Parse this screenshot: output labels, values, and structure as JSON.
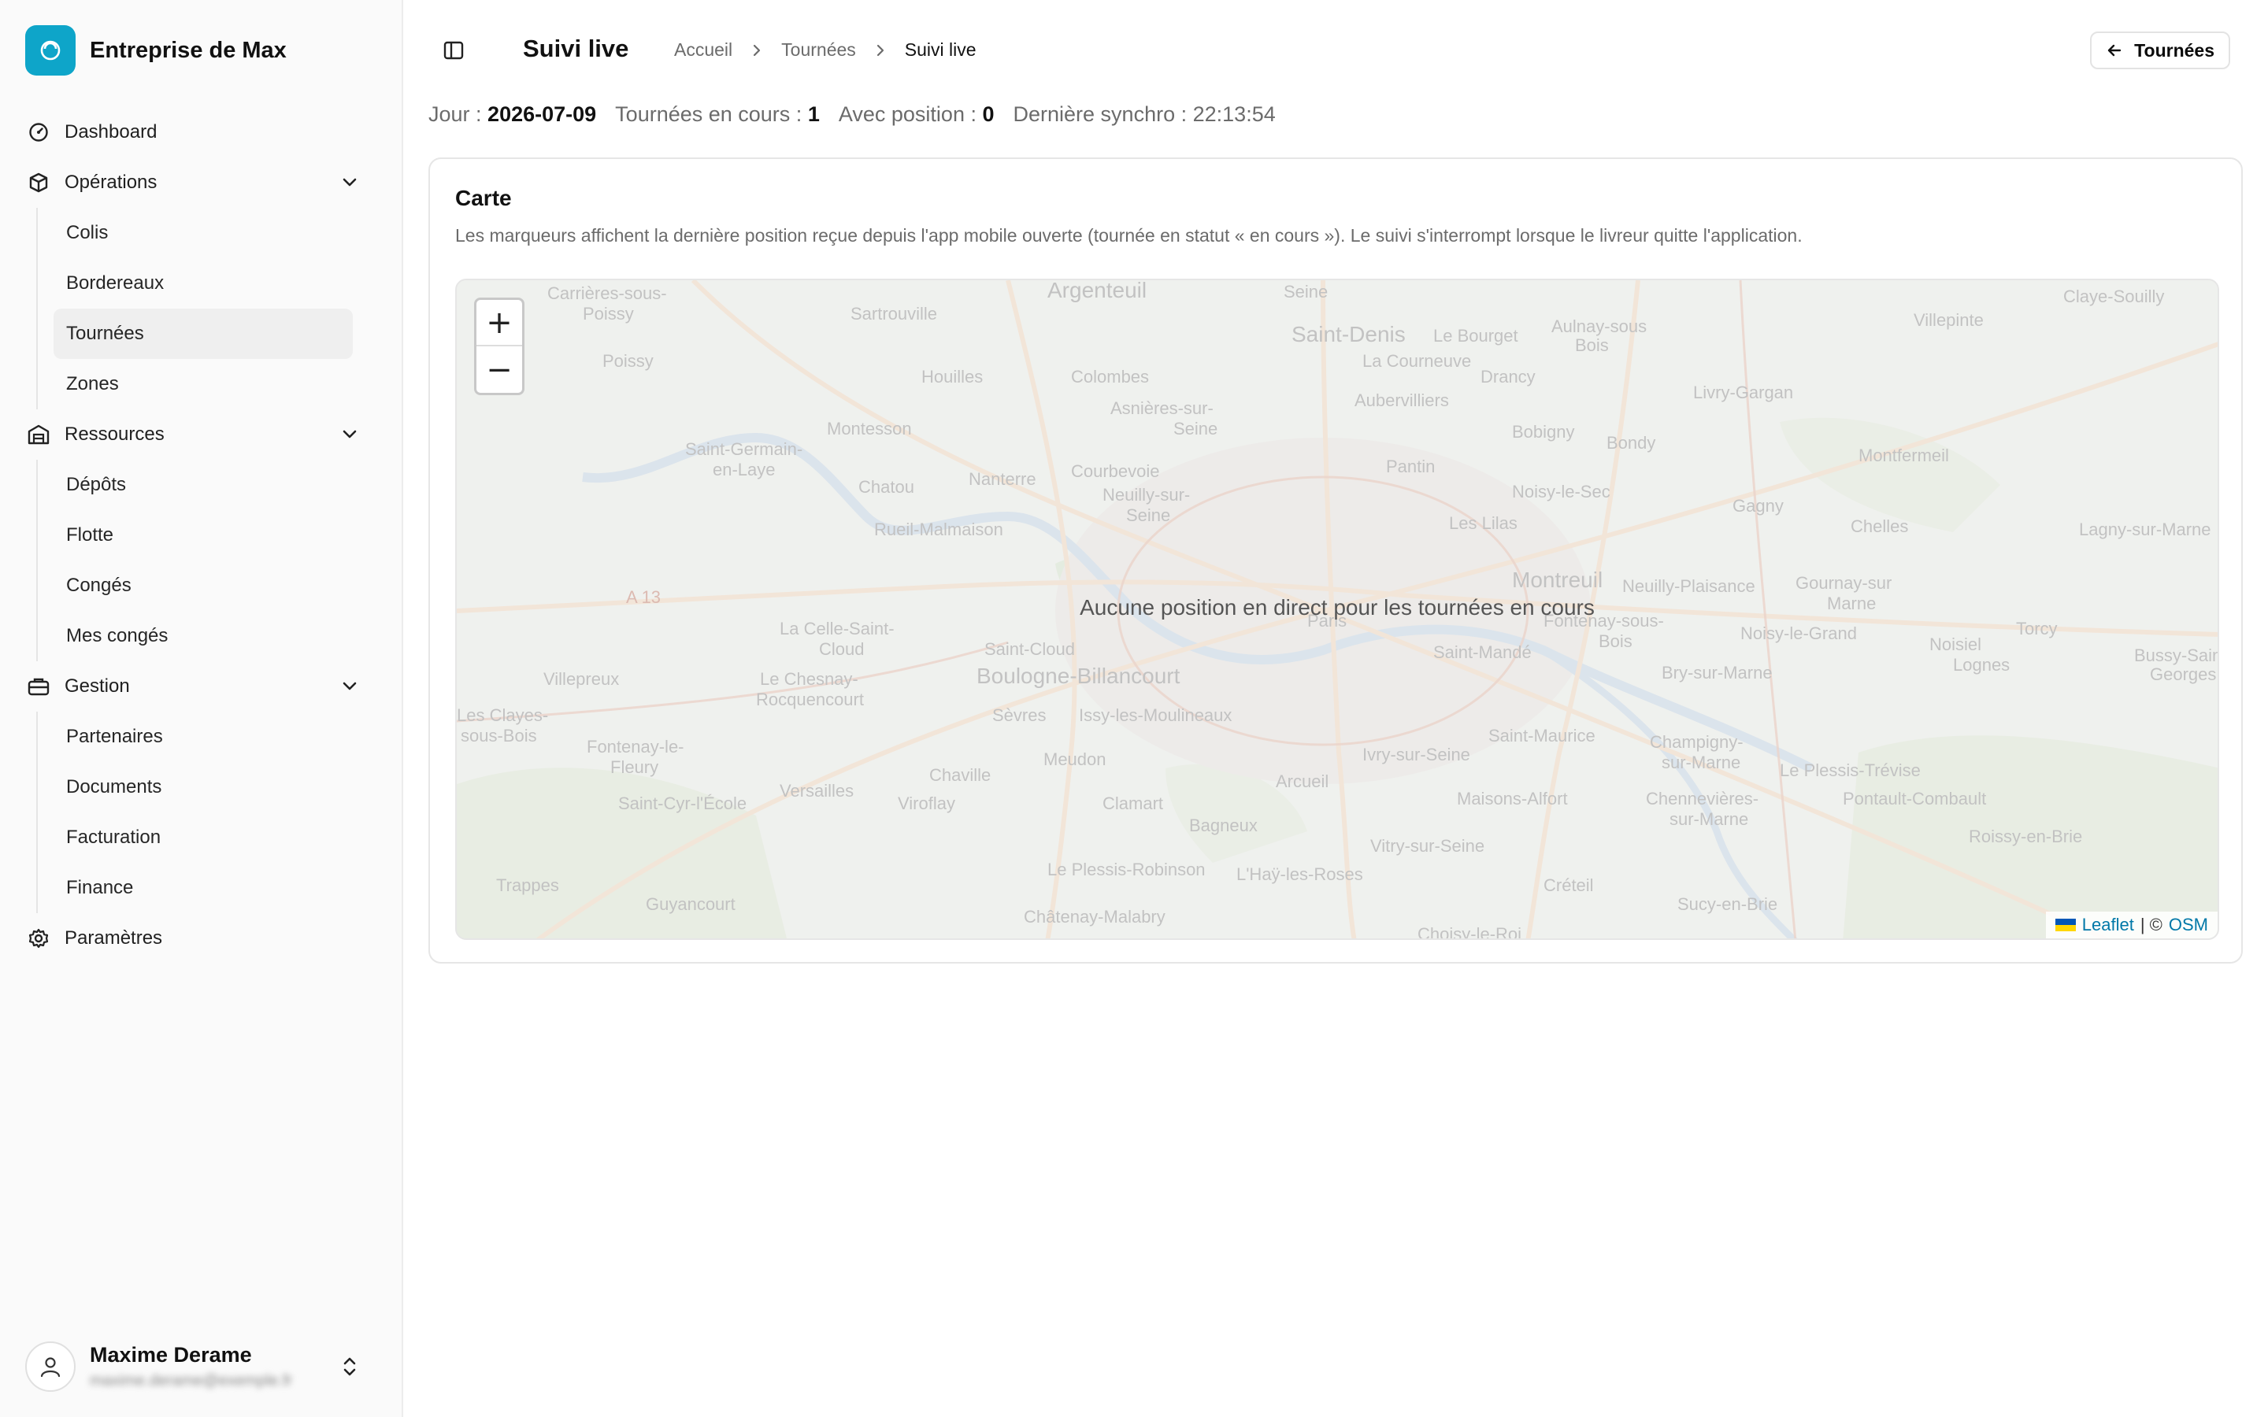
{
  "brand": {
    "name": "Entreprise de Max",
    "accent": "#0ea5c9"
  },
  "sidebar": {
    "dashboard": "Dashboard",
    "operations": {
      "label": "Opérations",
      "items": [
        "Colis",
        "Bordereaux",
        "Tournées",
        "Zones"
      ],
      "active": "Tournées"
    },
    "ressources": {
      "label": "Ressources",
      "items": [
        "Dépôts",
        "Flotte",
        "Congés",
        "Mes congés"
      ]
    },
    "gestion": {
      "label": "Gestion",
      "items": [
        "Partenaires",
        "Documents",
        "Facturation",
        "Finance"
      ]
    },
    "parametres": "Paramètres"
  },
  "user": {
    "name": "Maxime Derame",
    "email": "maxime.derame@exemple.fr"
  },
  "header": {
    "title": "Suivi live",
    "breadcrumb": [
      "Accueil",
      "Tournées",
      "Suivi live"
    ],
    "back_label": "Tournées"
  },
  "stats": {
    "day_label": "Jour :",
    "day_value": "2026-07-09",
    "tours_label": "Tournées en cours :",
    "tours_value": "1",
    "position_label": "Avec position :",
    "position_value": "0",
    "sync_label": "Dernière synchro :",
    "sync_value": "22:13:54"
  },
  "card": {
    "title": "Carte",
    "description": "Les marqueurs affichent la dernière position reçue depuis l'app mobile ouverte (tournée en statut « en cours »). Le suivi s'interrompt lorsque le livreur quitte l'application."
  },
  "map": {
    "empty_message": "Aucune position en direct pour les tournées en cours",
    "zoom_in": "+",
    "zoom_out": "−",
    "attribution_leaflet": "Leaflet",
    "attribution_sep": "| ©",
    "attribution_osm": "OSM",
    "places": [
      "Argenteuil",
      "Saint-Denis",
      "Le Bourget",
      "Aulnay-sous-Bois",
      "Villepinte",
      "Claye-Souilly",
      "Sartrouville",
      "Carrières-sous-Poissy",
      "Poissy",
      "Houilles",
      "Colombes",
      "La Courneuve",
      "Drancy",
      "Livry-Gargan",
      "Aubervilliers",
      "Asnières-sur-Seine",
      "Bobigny",
      "Bondy",
      "Montesson",
      "Saint-Germain-en-Laye",
      "Pantin",
      "Montfermeil",
      "Courbevoie",
      "Nanterre",
      "Chatou",
      "Neuilly-sur-Seine",
      "Noisy-le-Sec",
      "Gagny",
      "Chelles",
      "Rueil-Malmaison",
      "Les Lilas",
      "Lagny-sur-Marne",
      "Montreuil",
      "Neuilly-Plaisance",
      "Gournay-sur-Marne",
      "La Celle-Saint-Cloud",
      "Paris",
      "Fontenay-sous-Bois",
      "Noisy-le-Grand",
      "Torcy",
      "Noisiel",
      "Saint-Cloud",
      "Saint-Mandé",
      "Boulogne-Billancourt",
      "Bry-sur-Marne",
      "Lognes",
      "Bussy-Saint-Georges",
      "Villepreux",
      "Le Chesnay-Rocquencourt",
      "Sèvres",
      "Issy-les-Moulineaux",
      "Les Clayes-sous-Bois",
      "Fontenay-le-Fleury",
      "Meudon",
      "Saint-Maurice",
      "Champigny-sur-Marne",
      "Le Plessis-Trévise",
      "Ivry-sur-Seine",
      "Versailles",
      "Chaville",
      "Arcueil",
      "Maisons-Alfort",
      "Chennevières-sur-Marne",
      "Pontault-Combault",
      "Saint-Cyr-l'École",
      "Viroflay",
      "Clamart",
      "Bagneux",
      "Roissy-en-Brie",
      "Vitry-sur-Seine",
      "Trappes",
      "Le Plessis-Robinson",
      "L'Haÿ-les-Roses",
      "Créteil",
      "Guyancourt",
      "Châtenay-Malabry",
      "Sucy-en-Brie",
      "Choisy-le-Roi",
      "A 13"
    ]
  }
}
